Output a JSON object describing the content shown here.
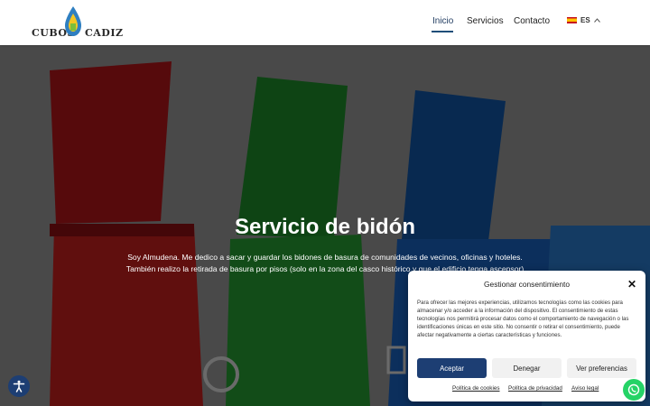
{
  "brand": {
    "left_text": "CUBOS",
    "right_text": "CADIZ"
  },
  "nav": {
    "items": [
      {
        "label": "Inicio",
        "active": true
      },
      {
        "label": "Servicios",
        "active": false
      },
      {
        "label": "Contacto",
        "active": false
      }
    ],
    "language": "ES"
  },
  "hero": {
    "title": "Servicio de bidón",
    "line1": "Soy Almudena. Me dedico a sacar y guardar los bidones de basura de comunidades de vecinos, oficinas y hoteles.",
    "line2": "También realizo la retirada de basura por pisos (solo en la zona del casco histórico y que el edificio tenga ascensor)"
  },
  "consent": {
    "title": "Gestionar consentimiento",
    "text": "Para ofrecer las mejores experiencias, utilizamos tecnologías como las cookies para almacenar y/o acceder a la información del dispositivo. El consentimiento de estas tecnologías nos permitirá procesar datos como el comportamiento de navegación o las identificaciones únicas en este sitio. No consentir o retirar el consentimiento, puede afectar negativamente a ciertas características y funciones.",
    "accept_label": "Aceptar",
    "deny_label": "Denegar",
    "prefs_label": "Ver preferencias",
    "links": [
      "Política de cookies",
      "Política de privacidad",
      "Aviso legal"
    ]
  },
  "colors": {
    "accent": "#1d3e73",
    "whatsapp": "#25d366"
  }
}
